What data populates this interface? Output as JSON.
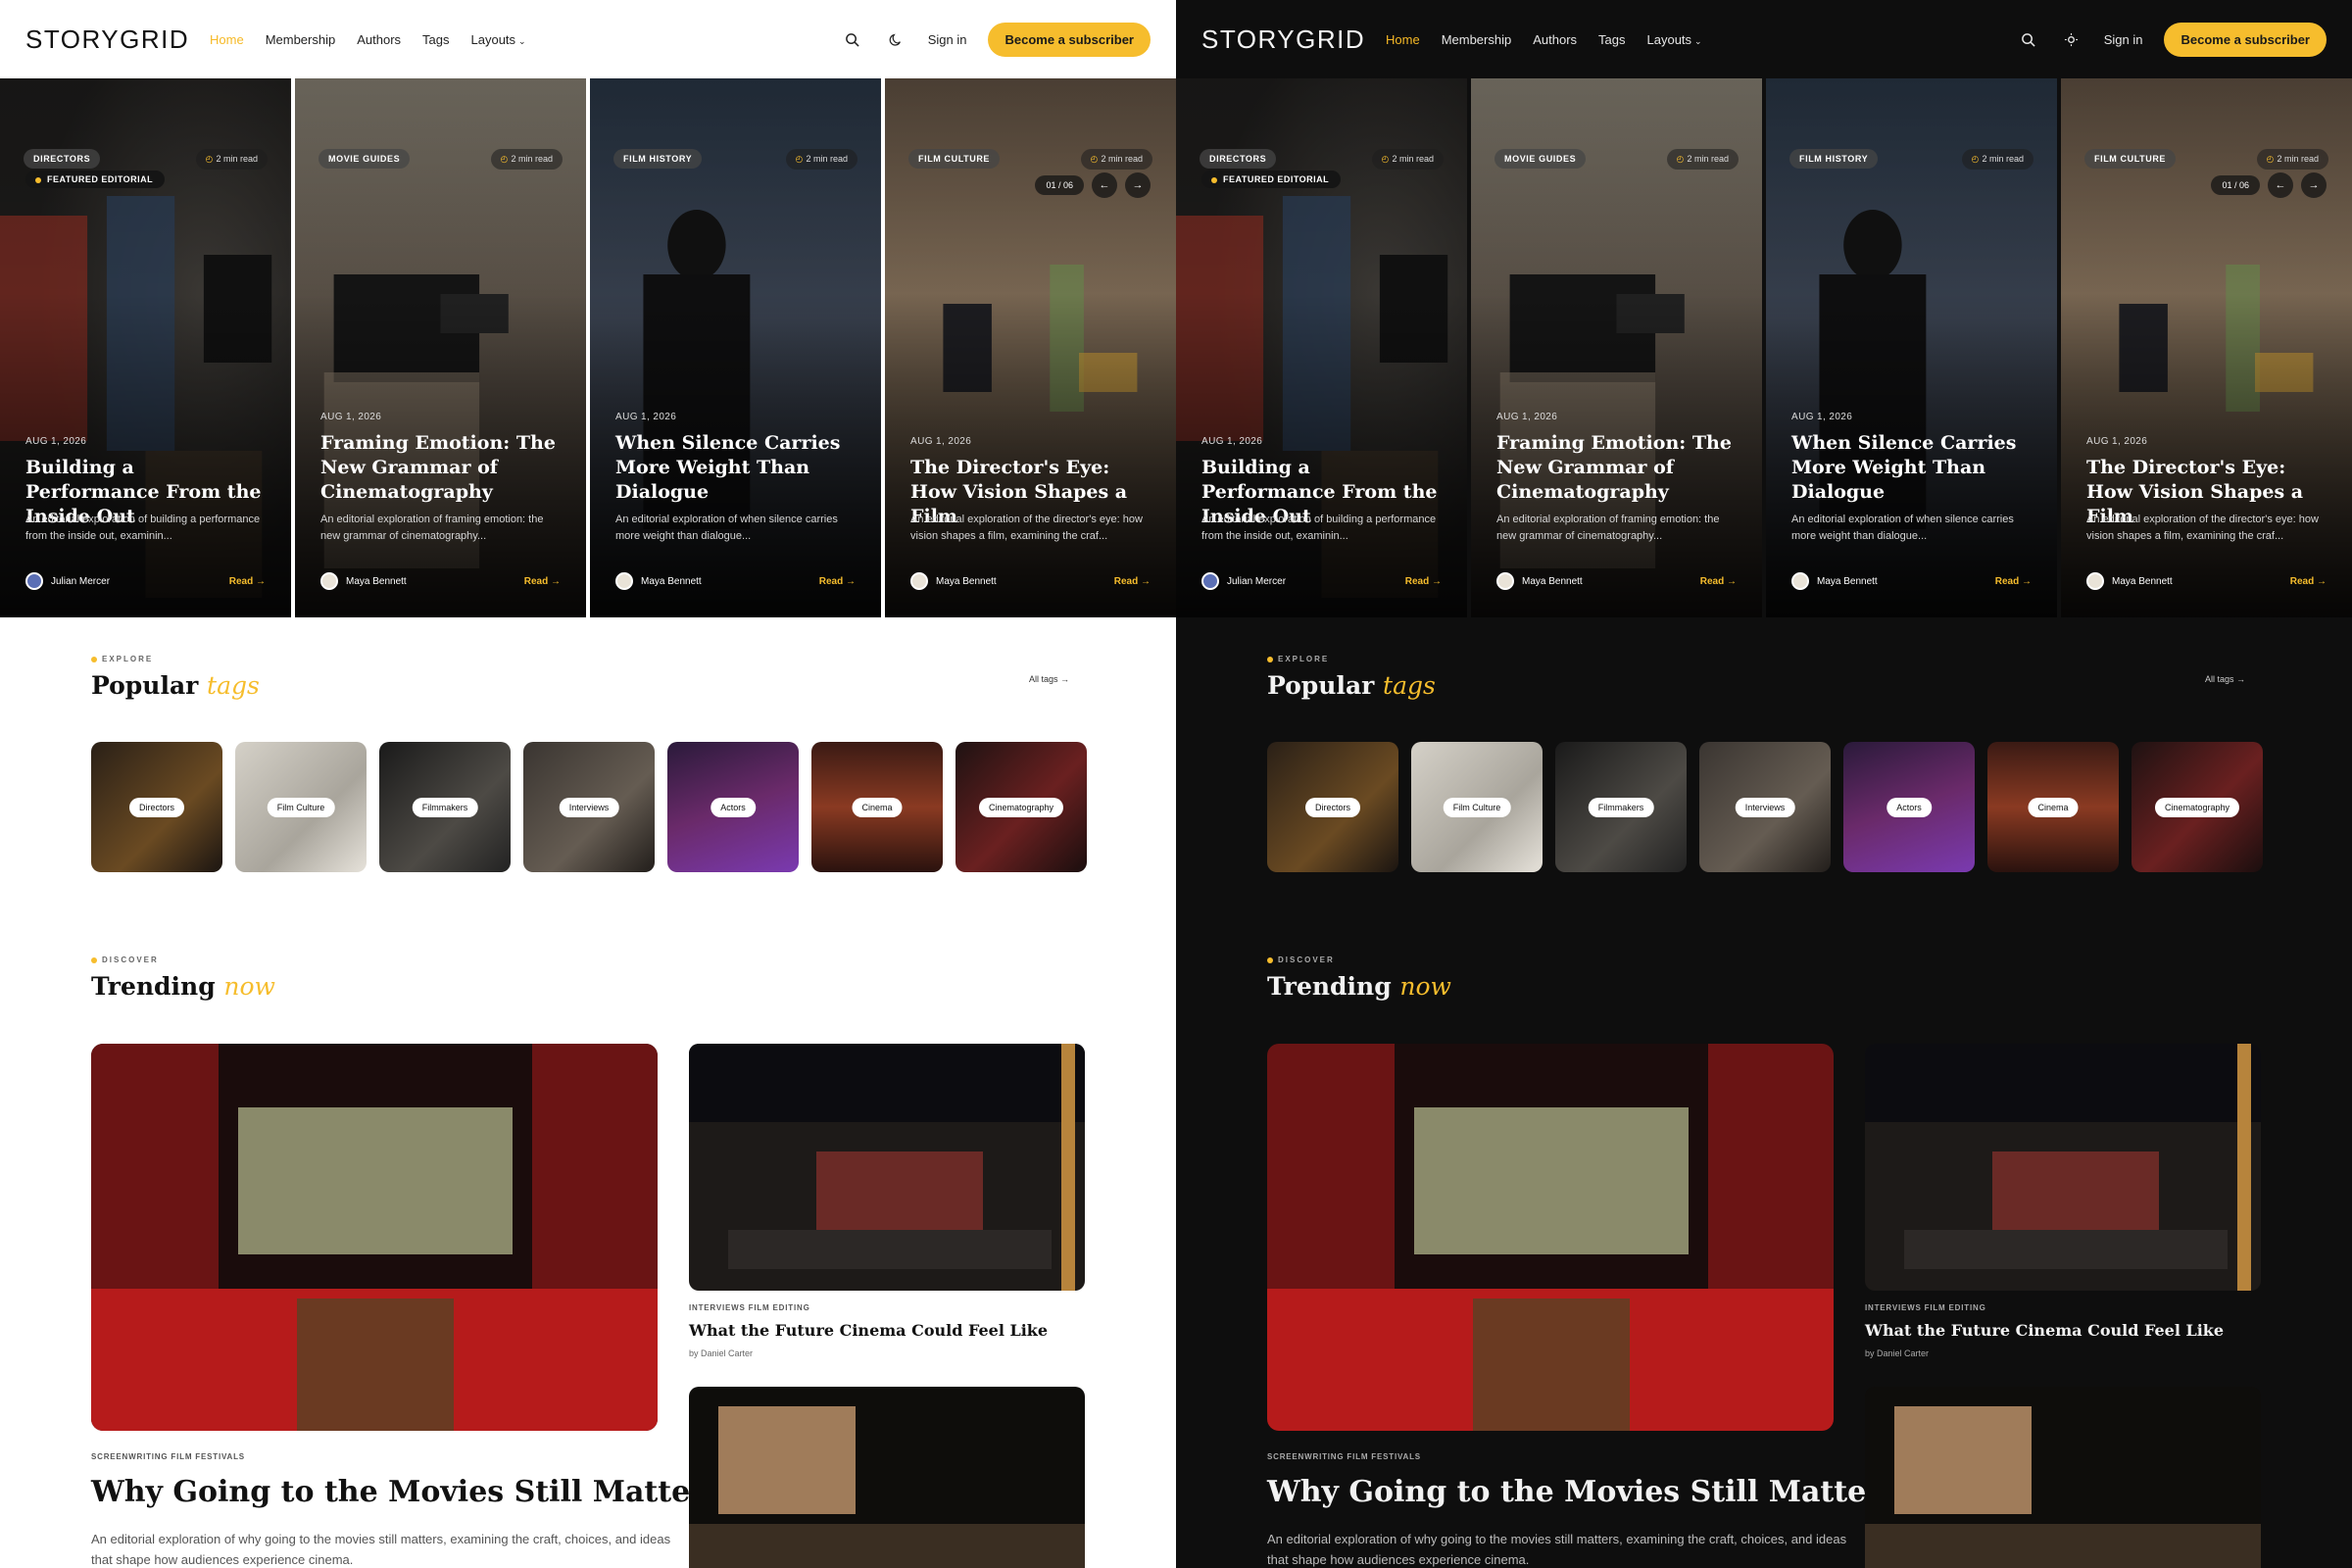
{
  "brand": {
    "logo": "STORYGRID",
    "accent": "#f6bd2d"
  },
  "nav": {
    "home": "Home",
    "membership": "Membership",
    "authors": "Authors",
    "tags": "Tags",
    "layouts": "Layouts"
  },
  "header": {
    "signin": "Sign in",
    "cta": "Become a subscriber",
    "search_icon": "search-icon",
    "theme_icon_light": "moon-icon",
    "theme_icon_dark": "sun-icon"
  },
  "hero": {
    "featured": "FEATURED EDITORIAL",
    "counter": "01 / 06",
    "cards": [
      {
        "tag": "DIRECTORS",
        "read_time": "2 min read",
        "date": "AUG 1, 2026",
        "title": "Building a Performance From the Inside Out",
        "excerpt": "An editorial exploration of building a performance from the inside out, examinin...",
        "author": "Julian Mercer",
        "read": "Read"
      },
      {
        "tag": "MOVIE GUIDES",
        "read_time": "2 min read",
        "date": "AUG 1, 2026",
        "title": "Framing Emotion: The New Grammar of Cinematography",
        "excerpt": "An editorial exploration of framing emotion: the new grammar of cinematography...",
        "author": "Maya Bennett",
        "read": "Read"
      },
      {
        "tag": "FILM HISTORY",
        "read_time": "2 min read",
        "date": "AUG 1, 2026",
        "title": "When Silence Carries More Weight Than Dialogue",
        "excerpt": "An editorial exploration of when silence carries more weight than dialogue...",
        "author": "Maya Bennett",
        "read": "Read"
      },
      {
        "tag": "FILM CULTURE",
        "read_time": "2 min read",
        "date": "AUG 1, 2026",
        "title": "The Director's Eye: How Vision Shapes a Film",
        "excerpt": "An editorial exploration of the director's eye: how vision shapes a film, examining the craf...",
        "author": "Maya Bennett",
        "read": "Read"
      }
    ]
  },
  "tags_section": {
    "kicker": "EXPLORE",
    "title": "Popular",
    "title_em": "tags",
    "all_tags": "All tags",
    "items": [
      "Directors",
      "Film Culture",
      "Filmmakers",
      "Interviews",
      "Actors",
      "Cinema",
      "Cinematography"
    ]
  },
  "trending": {
    "kicker": "DISCOVER",
    "title": "Trending",
    "title_em": "now",
    "big": {
      "tags": "SCREENWRITING  FILM FESTIVALS",
      "title": "Why Going to the Movies Still Matters",
      "excerpt": "An editorial exploration of why going to the movies still matters, examining the craft, choices, and ideas that shape how audiences experience cinema."
    },
    "small": {
      "tags": "INTERVIEWS  FILM EDITING",
      "title": "What the Future Cinema Could Feel Like",
      "by": "by Daniel Carter"
    }
  }
}
